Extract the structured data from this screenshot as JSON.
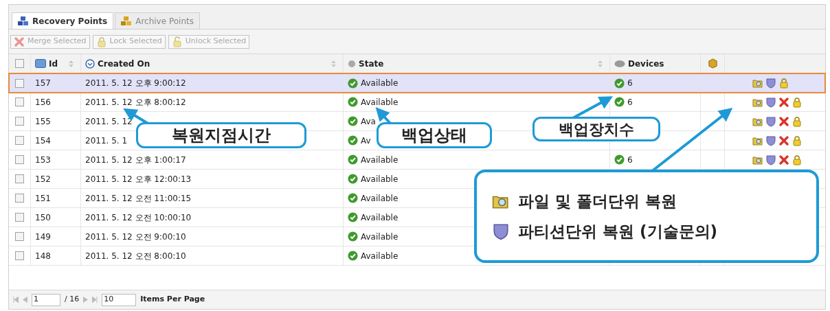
{
  "tabs": [
    {
      "label": "Recovery Points",
      "selected": true
    },
    {
      "label": "Archive Points",
      "selected": false
    }
  ],
  "toolbar": [
    {
      "label": "Merge Selected",
      "kind": "merge",
      "disabled": true
    },
    {
      "label": "Lock Selected",
      "kind": "lock",
      "disabled": true
    },
    {
      "label": "Unlock Selected",
      "kind": "unlock",
      "disabled": true
    }
  ],
  "table": {
    "header_checkbox": {
      "checked": false
    },
    "columns": [
      "Id",
      "Created On",
      "State",
      "Devices"
    ],
    "rows": [
      {
        "id": "157",
        "created": "2011. 5. 12 오후 9:00:12",
        "state": "Available",
        "devices": "6",
        "actions": [
          {
            "kind": "file"
          },
          {
            "kind": "partition"
          },
          {
            "kind": "lock"
          }
        ],
        "checked": false,
        "selected": true
      },
      {
        "id": "156",
        "created": "2011. 5. 12 오후 8:00:12",
        "state": "Available",
        "devices": "6",
        "actions": [
          {
            "kind": "file"
          },
          {
            "kind": "partition"
          },
          {
            "kind": "merge"
          },
          {
            "kind": "lock"
          }
        ],
        "checked": false,
        "selected": false
      },
      {
        "id": "155",
        "created": "2011. 5. 12",
        "state": "Ava",
        "actions": [
          {
            "kind": "file"
          },
          {
            "kind": "partition"
          },
          {
            "kind": "merge"
          },
          {
            "kind": "lock"
          }
        ],
        "checked": false,
        "selected": false
      },
      {
        "id": "154",
        "created": "2011. 5. 1",
        "state": "Av",
        "actions": [
          {
            "kind": "file"
          },
          {
            "kind": "partition"
          },
          {
            "kind": "merge"
          },
          {
            "kind": "lock"
          }
        ],
        "checked": false,
        "selected": false
      },
      {
        "id": "153",
        "created": "2011. 5. 12 오후 1:00:17",
        "state": "Available",
        "devices": "6",
        "actions": [
          {
            "kind": "file"
          },
          {
            "kind": "partition"
          },
          {
            "kind": "merge"
          },
          {
            "kind": "lock"
          }
        ],
        "checked": false,
        "selected": false
      },
      {
        "id": "152",
        "created": "2011. 5. 12 오후 12:00:13",
        "state": "Available",
        "checked": false,
        "selected": false
      },
      {
        "id": "151",
        "created": "2011. 5. 12 오전 11:00:15",
        "state": "Available",
        "checked": false,
        "selected": false
      },
      {
        "id": "150",
        "created": "2011. 5. 12 오전 10:00:10",
        "state": "Available",
        "checked": false,
        "selected": false
      },
      {
        "id": "149",
        "created": "2011. 5. 12 오전 9:00:10",
        "state": "Available",
        "checked": false,
        "selected": false
      },
      {
        "id": "148",
        "created": "2011. 5. 12 오전 8:00:10",
        "state": "Available",
        "checked": false,
        "selected": false
      }
    ]
  },
  "pager": {
    "page": "1",
    "total": "/ 16",
    "per_page": "10",
    "per_page_label": "Items Per Page"
  },
  "callouts": [
    {
      "text": "복원지점시간"
    },
    {
      "text": "백업상태"
    },
    {
      "text": "백업장치수"
    }
  ],
  "legend": [
    {
      "kind": "file",
      "text": "파일 및 폴더단위 복원"
    },
    {
      "kind": "partition",
      "text": "파티션단위 복원 (기술문의)"
    }
  ]
}
